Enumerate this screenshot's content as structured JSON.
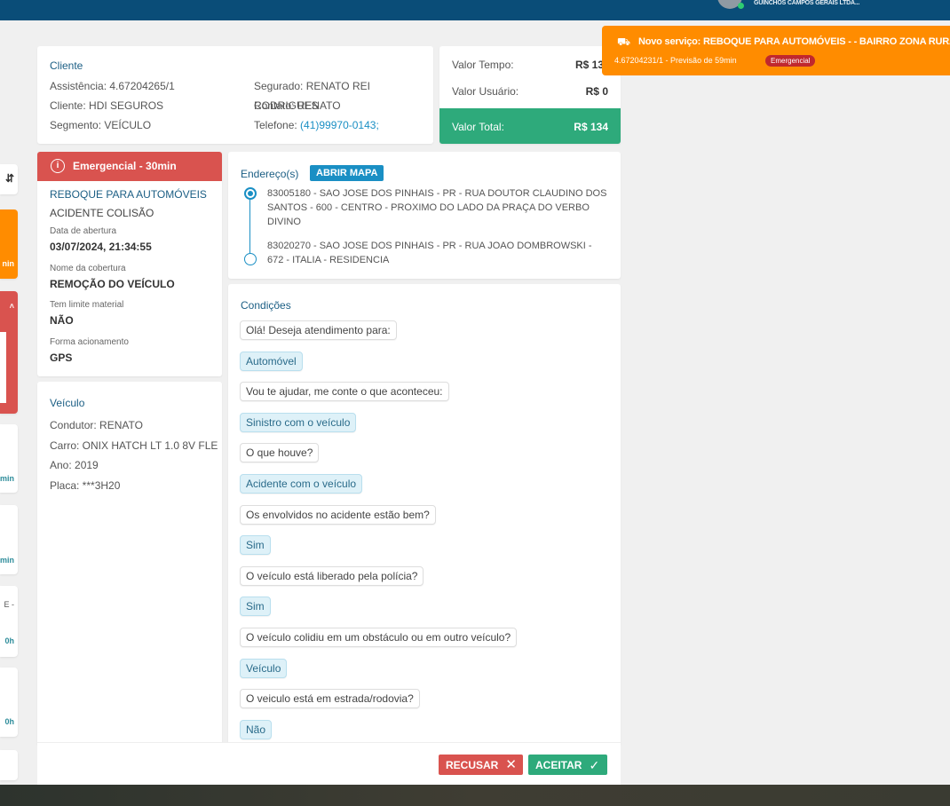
{
  "header": {
    "company": "GUINCHOS CAMPOS GERAIS LTDA..."
  },
  "notification": {
    "title": "Novo serviço: REBOQUE PARA AUTOMÓVEIS - - BAIRRO ZONA RURAL",
    "subtitle": "4.67204231/1 - Previsão de 59min",
    "badge": "Emergencial"
  },
  "left_list": {
    "t1": "nin",
    "t2": "min",
    "t3": "min",
    "t4": "E -",
    "t5": "0h",
    "t6": "0h"
  },
  "cliente": {
    "title": "Cliente",
    "assistencia": "Assistência: 4.67204265/1",
    "cliente": "Cliente: HDI SEGUROS",
    "segmento": "Segmento: VEÍCULO",
    "segurado": "Segurado: RENATO REI RODRIGUES",
    "contato": "Contato: RENATO",
    "telefone_label": "Telefone:",
    "telefone": "(41)99970-0143;"
  },
  "valores": {
    "tempo_label": "Valor Tempo:",
    "tempo": "R$ 13",
    "usuario_label": "Valor Usuário:",
    "usuario": "R$ 0",
    "total_label": "Valor Total:",
    "total": "R$ 134"
  },
  "servico": {
    "header": "Emergencial - 30min",
    "tipo": "REBOQUE PARA AUTOMÓVEIS",
    "motivo": "ACIDENTE COLISÃO",
    "data_label": "Data de abertura",
    "data": "03/07/2024, 21:34:55",
    "cobertura_label": "Nome da cobertura",
    "cobertura": "REMOÇÃO DO VEÍCULO",
    "limite_label": "Tem limite material",
    "limite": "NÃO",
    "forma_label": "Forma acionamento",
    "forma": "GPS"
  },
  "enderecos": {
    "title": "Endereço(s)",
    "map_button": "ABRIR MAPA",
    "origem": "83005180 - SAO JOSE DOS PINHAIS - PR - RUA DOUTOR CLAUDINO DOS SANTOS - 600 - CENTRO - PROXIMO DO LADO DA PRAÇA DO VERBO DIVINO",
    "destino": "83020270 - SAO JOSE DOS PINHAIS - PR - RUA JOAO DOMBROWSKI - 672 - ITALIA - RESIDENCIA"
  },
  "veiculo": {
    "title": "Veículo",
    "condutor": "Condutor: RENATO",
    "carro": "Carro: ONIX HATCH LT 1.0 8V FLE",
    "ano": "Ano: 2019",
    "placa": "Placa: ***3H20"
  },
  "condicoes": {
    "title": "Condições",
    "items": [
      {
        "q": "Olá! Deseja atendimento para:",
        "a": "Automóvel"
      },
      {
        "q": "Vou te ajudar, me conte o que aconteceu:",
        "a": "Sinistro com o veículo"
      },
      {
        "q": "O que houve?",
        "a": "Acidente com o veículo"
      },
      {
        "q": "Os envolvidos no acidente estão bem?",
        "a": "Sim"
      },
      {
        "q": "O veículo está liberado pela polícia?",
        "a": "Sim"
      },
      {
        "q": "O veículo colidiu em um obstáculo ou em outro veículo?",
        "a": "Veículo"
      },
      {
        "q": "O veiculo está em estrada/rodovia?",
        "a": "Não"
      }
    ]
  },
  "actions": {
    "recusar": "RECUSAR",
    "aceitar": "ACEITAR"
  },
  "colors": {
    "primary": "#0a4d78",
    "danger": "#d9534f",
    "success": "#2eaa7b",
    "warning": "#ff8c00",
    "link": "#1a8fc4"
  }
}
